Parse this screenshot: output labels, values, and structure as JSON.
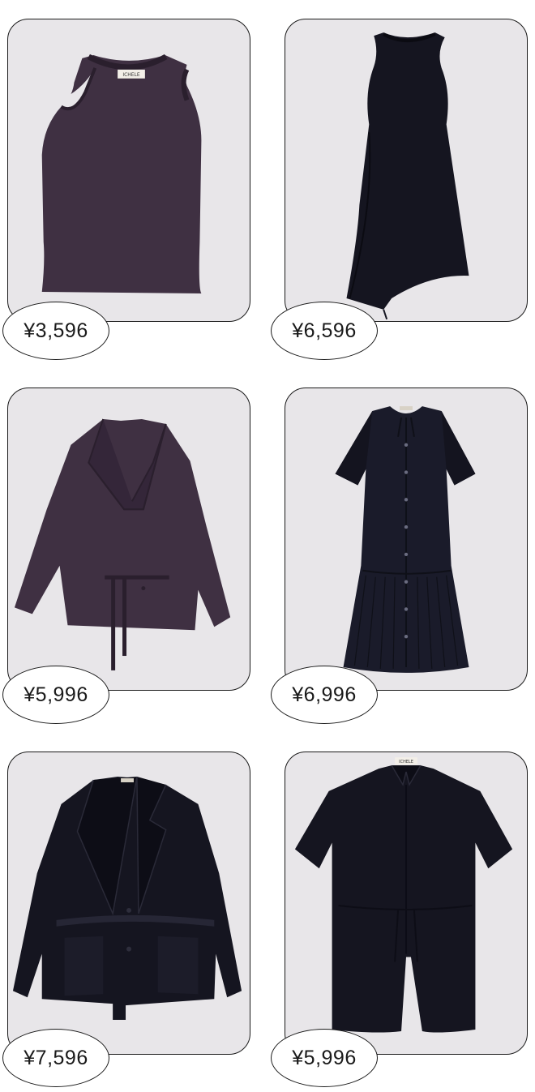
{
  "colors": {
    "card_bg": "#e8e6e9",
    "plum": "#3f3042",
    "plum_dark": "#2e2231",
    "black_garment": "#151520",
    "navy_garment": "#1a1b2a",
    "outline": "#1a1a1a"
  },
  "products": [
    {
      "item": "cut-out sleeveless top",
      "color": "plum",
      "price": "¥3,596",
      "tag": "ICHELE"
    },
    {
      "item": "asymmetric sleeveless dress",
      "color": "black",
      "price": "¥6,596"
    },
    {
      "item": "belted tailored jacket",
      "color": "plum",
      "price": "¥5,996"
    },
    {
      "item": "short-sleeve pleated shirt dress",
      "color": "navy",
      "price": "¥6,996"
    },
    {
      "item": "layered hem blazer",
      "color": "black",
      "price": "¥7,596",
      "tag": "ICHELE"
    },
    {
      "item": "short-sleeve shirt romper",
      "color": "black",
      "price": "¥5,996",
      "tag": "ICHELE"
    }
  ]
}
